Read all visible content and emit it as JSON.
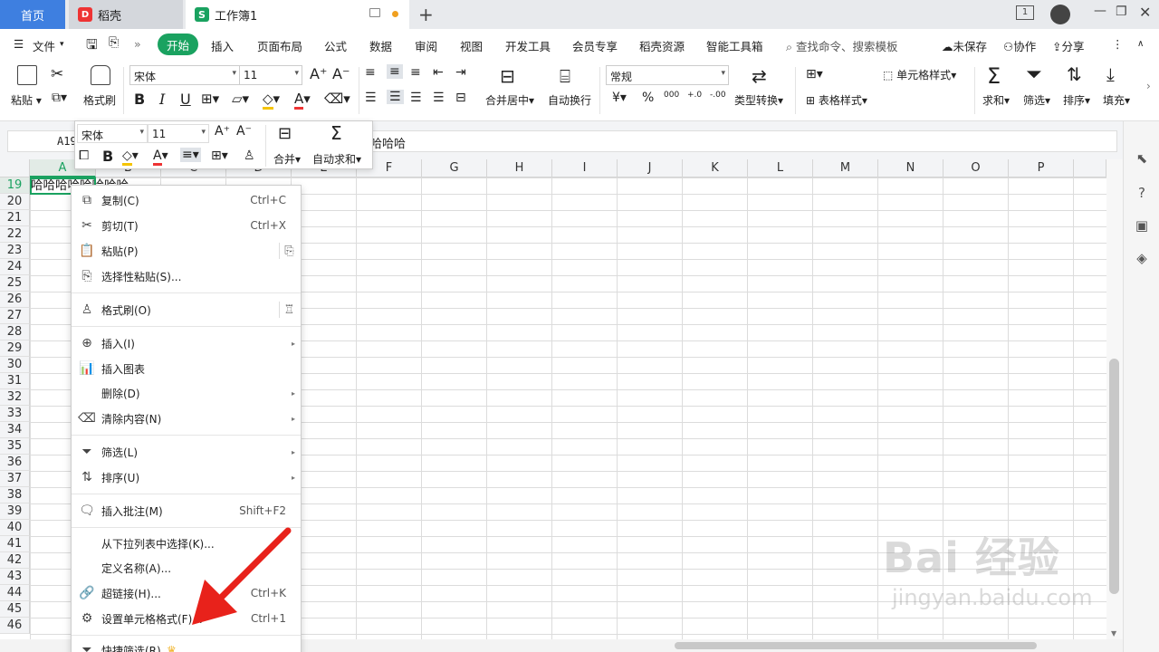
{
  "titlebar": {
    "home_tab": "首页",
    "docer_tab": "稻壳",
    "docer_logo": "D",
    "workbook_tab": "工作簿1",
    "workbook_logo": "S",
    "page_indicator": "1"
  },
  "menubar": {
    "file": "文件",
    "tabs": [
      "开始",
      "插入",
      "页面布局",
      "公式",
      "数据",
      "审阅",
      "视图",
      "开发工具",
      "会员专享",
      "稻壳资源",
      "智能工具箱"
    ],
    "search_placeholder": "查找命令、搜索模板",
    "unsaved": "未保存",
    "collab": "协作",
    "share": "分享"
  },
  "ribbon": {
    "paste": "粘贴",
    "cut_label": "",
    "format_painter": "格式刷",
    "font_name": "宋体",
    "font_size": "11",
    "bold": "B",
    "italic": "I",
    "underline": "U",
    "font_color_letter": "A",
    "merge_center": "合并居中",
    "wrap_text": "自动换行",
    "number_format": "常规",
    "type_convert": "类型转换",
    "cell_style": "单元格样式",
    "table_style": "表格样式",
    "sum": "求和",
    "filter": "筛选",
    "sort": "排序",
    "fill": "填充",
    "currency": "¥",
    "percent": "%",
    "thousands": "000",
    "inc_decimal": "+.0",
    "dec_decimal": "-.00"
  },
  "formulabar": {
    "namebox": "A19",
    "content": "哈哈哈"
  },
  "minibar": {
    "font_name": "宋体",
    "font_size": "11",
    "bold": "B",
    "font_color_letter": "A",
    "merge": "合并",
    "autosum": "自动求和"
  },
  "sheet": {
    "columns": [
      "A",
      "B",
      "C",
      "D",
      "E",
      "F",
      "G",
      "H",
      "I",
      "J",
      "K",
      "L",
      "M",
      "N",
      "O",
      "P"
    ],
    "rows": [
      "19",
      "20",
      "21",
      "22",
      "23",
      "24",
      "25",
      "26",
      "27",
      "28",
      "29",
      "30",
      "31",
      "32",
      "33",
      "34",
      "35",
      "36",
      "37",
      "38",
      "39",
      "40",
      "41",
      "42",
      "43",
      "44",
      "45",
      "46"
    ],
    "cell_a19": "哈哈哈哈哈哈哈哈"
  },
  "context_menu": {
    "copy": "复制(C)",
    "copy_short": "Ctrl+C",
    "cut": "剪切(T)",
    "cut_short": "Ctrl+X",
    "paste": "粘贴(P)",
    "paste_special": "选择性粘贴(S)...",
    "format_painter": "格式刷(O)",
    "insert": "插入(I)",
    "insert_chart": "插入图表",
    "delete": "删除(D)",
    "clear": "清除内容(N)",
    "filter": "筛选(L)",
    "sort": "排序(U)",
    "insert_comment": "插入批注(M)",
    "comment_short": "Shift+F2",
    "pick_list": "从下拉列表中选择(K)...",
    "define_name": "定义名称(A)...",
    "hyperlink": "超链接(H)...",
    "hyperlink_short": "Ctrl+K",
    "format_cells": "设置单元格格式(F)...",
    "format_cells_short": "Ctrl+1",
    "quick_filter": "快捷筛选(R)"
  },
  "watermark": {
    "main": "Bai 经验",
    "sub": "jingyan.baidu.com"
  },
  "colors": {
    "accent_green": "#1aa260",
    "home_blue": "#3e7fe0",
    "arrow_red": "#e8221b"
  }
}
